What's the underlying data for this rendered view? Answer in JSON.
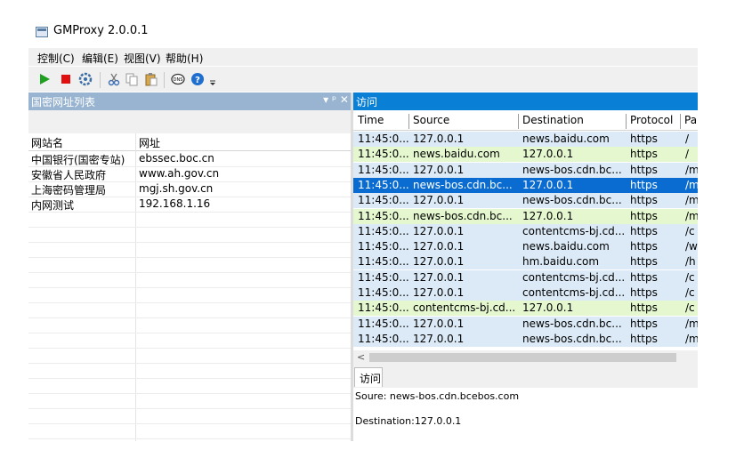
{
  "window": {
    "title": "GMProxy 2.0.0.1"
  },
  "menu": [
    "控制(C)",
    "编辑(E)",
    "视图(V)",
    "帮助(H)"
  ],
  "toolbar": {
    "icons": [
      "play-icon",
      "stop-icon",
      "settings-icon",
      "cut-icon",
      "copy-icon",
      "paste-icon",
      "dns-icon",
      "help-icon",
      "overflow-icon"
    ],
    "colors": {
      "play": "#20a020",
      "stop": "#e01010",
      "accent": "#1f6fd1"
    }
  },
  "left_panel": {
    "title": "国密网址列表",
    "controls": "▾ ᵖ ✕",
    "columns": [
      "网站名",
      "网址"
    ],
    "rows": [
      {
        "name": "中国银行(国密专站)",
        "url": "ebssec.boc.cn"
      },
      {
        "name": "安徽省人民政府",
        "url": "www.ah.gov.cn"
      },
      {
        "name": "上海密码管理局",
        "url": "mgj.sh.gov.cn"
      },
      {
        "name": "内网测试",
        "url": "192.168.1.16"
      }
    ]
  },
  "right_panel": {
    "title": "访问",
    "columns": [
      "Time",
      "Source",
      "Destination",
      "Protocol",
      "Pa"
    ],
    "rows": [
      {
        "time": "11:45:0...",
        "source": "127.0.0.1",
        "dest": "news.baidu.com",
        "proto": "https",
        "path": "/",
        "style": "blue"
      },
      {
        "time": "11:45:0...",
        "source": "news.baidu.com",
        "dest": "127.0.0.1",
        "proto": "https",
        "path": "/",
        "style": "green"
      },
      {
        "time": "11:45:0...",
        "source": "127.0.0.1",
        "dest": "news-bos.cdn.bc...",
        "proto": "https",
        "path": "/m",
        "style": "blue"
      },
      {
        "time": "11:45:0...",
        "source": "news-bos.cdn.bc...",
        "dest": "127.0.0.1",
        "proto": "https",
        "path": "/m",
        "style": "sel"
      },
      {
        "time": "11:45:0...",
        "source": "127.0.0.1",
        "dest": "news-bos.cdn.bc...",
        "proto": "https",
        "path": "/m",
        "style": "blue"
      },
      {
        "time": "11:45:0...",
        "source": "news-bos.cdn.bc...",
        "dest": "127.0.0.1",
        "proto": "https",
        "path": "/m",
        "style": "green"
      },
      {
        "time": "11:45:0...",
        "source": "127.0.0.1",
        "dest": "contentcms-bj.cd...",
        "proto": "https",
        "path": "/c",
        "style": "blue"
      },
      {
        "time": "11:45:0...",
        "source": "127.0.0.1",
        "dest": "news.baidu.com",
        "proto": "https",
        "path": "/w",
        "style": "blue"
      },
      {
        "time": "11:45:0...",
        "source": "127.0.0.1",
        "dest": "hm.baidu.com",
        "proto": "https",
        "path": "/h",
        "style": "blue"
      },
      {
        "time": "11:45:0...",
        "source": "127.0.0.1",
        "dest": "contentcms-bj.cd...",
        "proto": "https",
        "path": "/c",
        "style": "blue"
      },
      {
        "time": "11:45:0...",
        "source": "127.0.0.1",
        "dest": "contentcms-bj.cd...",
        "proto": "https",
        "path": "/c",
        "style": "blue"
      },
      {
        "time": "11:45:0...",
        "source": "contentcms-bj.cd...",
        "dest": "127.0.0.1",
        "proto": "https",
        "path": "/c",
        "style": "green"
      },
      {
        "time": "11:45:0...",
        "source": "127.0.0.1",
        "dest": "news-bos.cdn.bc...",
        "proto": "https",
        "path": "/m",
        "style": "blue"
      },
      {
        "time": "11:45:0...",
        "source": "127.0.0.1",
        "dest": "news-bos.cdn.bc...",
        "proto": "https",
        "path": "/m",
        "style": "blue"
      }
    ],
    "scroll_left": "<",
    "tab_label": "访问",
    "detail": {
      "source": "Soure: news-bos.cdn.bcebos.com",
      "destination": "Destination:127.0.0.1"
    }
  }
}
